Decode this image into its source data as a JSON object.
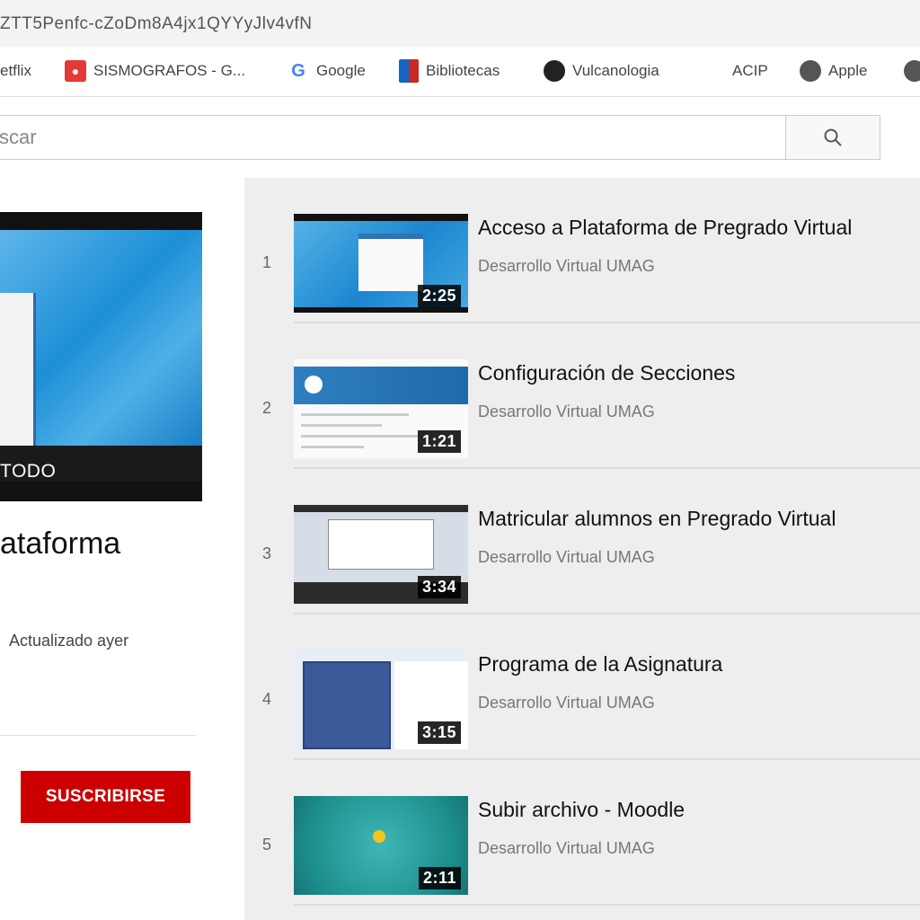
{
  "browser": {
    "url": "ZTT5Penfc-cZoDm8A4jx1QYYyJlv4vfN",
    "bookmarks": [
      {
        "label": "etflix",
        "icon": "netflix-icon"
      },
      {
        "label": "SISMOGRAFOS - G...",
        "icon": "map-pin-icon"
      },
      {
        "label": "Google",
        "icon": "google-icon"
      },
      {
        "label": "Bibliotecas",
        "icon": "library-icon"
      },
      {
        "label": "Vulcanologia",
        "icon": "globe-icon"
      },
      {
        "label": "ACIP",
        "icon": ""
      },
      {
        "label": "Apple",
        "icon": "globe-icon"
      }
    ]
  },
  "search": {
    "value": "scar"
  },
  "playlist": {
    "thumb_label": "TODO",
    "title": "ataforma",
    "updated": "Actualizado ayer",
    "subscribe_label": "SUSCRIBIRSE"
  },
  "videos": [
    {
      "index": "1",
      "title": "Acceso a Plataforma de Pregrado Virtual",
      "channel": "Desarrollo Virtual UMAG",
      "duration": "2:25"
    },
    {
      "index": "2",
      "title": "Configuración de Secciones",
      "channel": "Desarrollo Virtual UMAG",
      "duration": "1:21"
    },
    {
      "index": "3",
      "title": "Matricular alumnos en Pregrado Virtual",
      "channel": "Desarrollo Virtual UMAG",
      "duration": "3:34"
    },
    {
      "index": "4",
      "title": "Programa de la Asignatura",
      "channel": "Desarrollo Virtual UMAG",
      "duration": "3:15"
    },
    {
      "index": "5",
      "title": "Subir archivo - Moodle",
      "channel": "Desarrollo Virtual UMAG",
      "duration": "2:11"
    }
  ],
  "colors": {
    "subscribe": "#cc0000",
    "list_background": "#eeeeee"
  }
}
